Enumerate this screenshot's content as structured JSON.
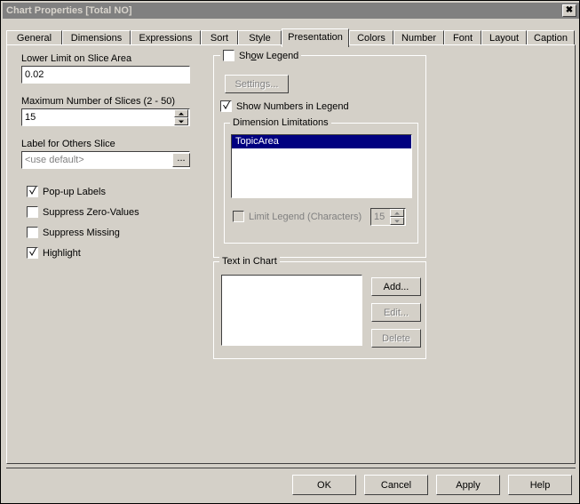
{
  "window": {
    "title": "Chart Properties [Total NO]",
    "close_icon": "close-icon",
    "colors": {
      "face": "#d4d0c8",
      "titlebar": "#808080",
      "title_text": "#d8d4cc",
      "selection": "#000080",
      "disabled_text": "#808080"
    }
  },
  "tabs": [
    {
      "label": "General",
      "selected": false
    },
    {
      "label": "Dimensions",
      "selected": false
    },
    {
      "label": "Expressions",
      "selected": false
    },
    {
      "label": "Sort",
      "selected": false
    },
    {
      "label": "Style",
      "selected": false
    },
    {
      "label": "Presentation",
      "selected": true
    },
    {
      "label": "Colors",
      "selected": false
    },
    {
      "label": "Number",
      "selected": false
    },
    {
      "label": "Font",
      "selected": false
    },
    {
      "label": "Layout",
      "selected": false
    },
    {
      "label": "Caption",
      "selected": false
    }
  ],
  "left_panel": {
    "lower_limit": {
      "label": "Lower Limit on Slice Area",
      "value": "0.02",
      "placeholder": ""
    },
    "max_slices": {
      "label": "Maximum Number of Slices (2 - 50)",
      "value": "15",
      "spinner": "up-down-spinner"
    },
    "others_label": {
      "label": "Label for Others Slice",
      "value": "",
      "placeholder": "<use default>",
      "browse_label": "..."
    },
    "checkboxes": [
      {
        "label": "Pop-up Labels",
        "checked": true,
        "enabled": true
      },
      {
        "label": "Suppress Zero-Values",
        "checked": false,
        "enabled": true
      },
      {
        "label": "Suppress Missing",
        "checked": false,
        "enabled": true
      },
      {
        "label": "Highlight",
        "checked": true,
        "enabled": true
      }
    ]
  },
  "legend_group": {
    "title_prefix": "Sh",
    "title_accel": "o",
    "title_suffix": "w Legend",
    "title": "Show Legend",
    "checked": false,
    "settings_button": {
      "label": "Settings...",
      "enabled": false
    },
    "show_numbers": {
      "label": "Show Numbers in Legend",
      "checked": true,
      "enabled": true
    },
    "dimension_limitations": {
      "title": "Dimension Limitations",
      "items": [
        "TopicArea"
      ],
      "selected_index": 0,
      "limit_legend": {
        "label": "Limit Legend (Characters)",
        "checked": false,
        "enabled": false,
        "value": "15"
      }
    }
  },
  "text_in_chart": {
    "title": "Text in Chart",
    "items": [],
    "buttons": [
      {
        "label": "Add...",
        "enabled": true
      },
      {
        "label": "Edit...",
        "enabled": false
      },
      {
        "label": "Delete",
        "enabled": false
      }
    ]
  },
  "footer": {
    "buttons": [
      {
        "label": "OK"
      },
      {
        "label": "Cancel"
      },
      {
        "label": "Apply"
      },
      {
        "label": "Help"
      }
    ]
  }
}
